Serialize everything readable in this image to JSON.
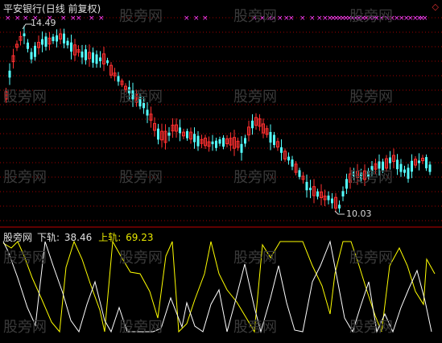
{
  "header": {
    "stock_name": "平安银行",
    "chart_mode": "(日线 前复权)"
  },
  "price_chart": {
    "high_label": "14.49",
    "low_label": "10.03"
  },
  "indicator": {
    "name": "股旁网",
    "lower_rail_label": "下轨:",
    "lower_rail_value": "38.46",
    "upper_rail_label": "上轨:",
    "upper_rail_value": "69.23"
  },
  "watermark": "股旁网",
  "icons": {
    "signal_marker": "x-mark-icon",
    "corner": "diamond-icon"
  },
  "colors": {
    "background": "#000000",
    "up_candle": "#ff3030",
    "down_candle": "#54ffff",
    "grid": "#a00000",
    "signal": "#ff40ff",
    "lower_line": "#ffffff",
    "upper_line": "#ffff00"
  },
  "chart_data": {
    "type": "candlestick",
    "price_extremes": {
      "high": 14.49,
      "low": 10.03
    },
    "indicator_values": {
      "lower_rail": 38.46,
      "upper_rail": 69.23
    }
  }
}
